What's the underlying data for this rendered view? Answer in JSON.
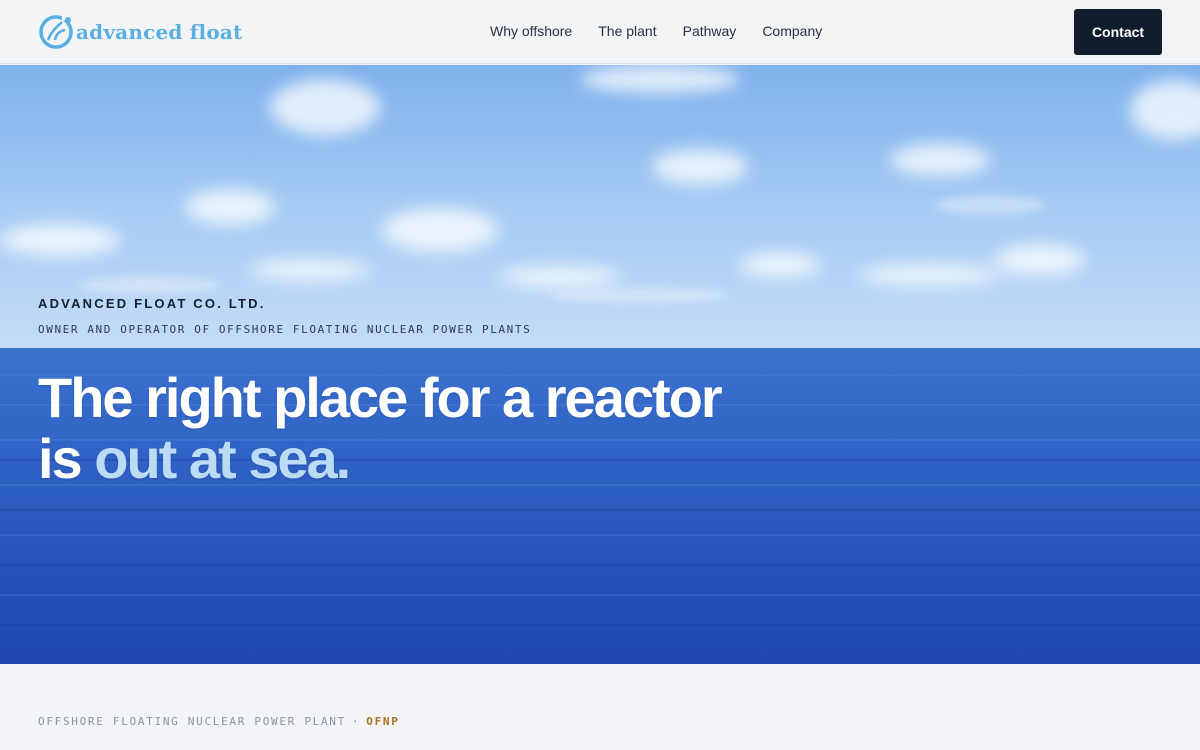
{
  "brand": {
    "logo_text": "advanced float",
    "logo_color": "#5aaee0"
  },
  "nav": {
    "items": [
      {
        "label": "Why offshore"
      },
      {
        "label": "The plant"
      },
      {
        "label": "Pathway"
      },
      {
        "label": "Company"
      }
    ],
    "contact_label": "Contact"
  },
  "hero": {
    "eyebrow": "ADVANCED FLOAT CO. LTD.",
    "subline": "OWNER AND OPERATOR OF OFFSHORE FLOATING NUCLEAR POWER PLANTS",
    "headline_part1": "The right place for a reactor is ",
    "headline_accent": "out at sea.",
    "background": "ocean-horizon-photo"
  },
  "section_label": {
    "text": "OFFSHORE FLOATING NUCLEAR POWER PLANT",
    "separator": "·",
    "code": "OFNP"
  },
  "colors": {
    "contact_button_bg": "#111c2e",
    "accent_text": "#bcdcf6",
    "code_color": "#a8741f"
  }
}
